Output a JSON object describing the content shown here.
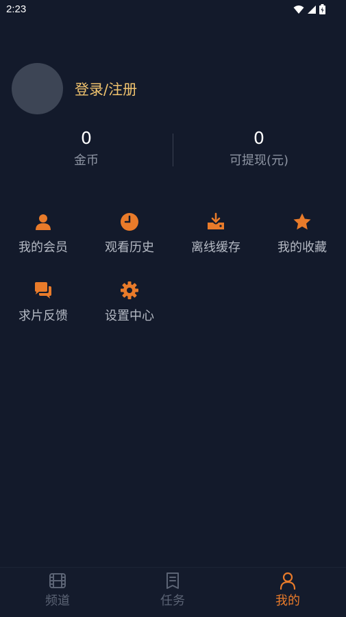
{
  "status_bar": {
    "time": "2:23"
  },
  "profile": {
    "login_label": "登录/注册"
  },
  "stats": {
    "coins": {
      "value": "0",
      "label": "金币"
    },
    "withdrawable": {
      "value": "0",
      "label": "可提现(元)"
    }
  },
  "menu": {
    "items": [
      {
        "label": "我的会员",
        "icon": "person-icon"
      },
      {
        "label": "观看历史",
        "icon": "clock-icon"
      },
      {
        "label": "离线缓存",
        "icon": "download-icon"
      },
      {
        "label": "我的收藏",
        "icon": "star-icon"
      },
      {
        "label": "求片反馈",
        "icon": "chat-icon"
      },
      {
        "label": "设置中心",
        "icon": "gear-icon"
      }
    ]
  },
  "tabbar": {
    "tabs": [
      {
        "label": "频道",
        "icon": "film-icon"
      },
      {
        "label": "任务",
        "icon": "task-icon"
      },
      {
        "label": "我的",
        "icon": "user-icon",
        "active": true
      }
    ]
  },
  "colors": {
    "background": "#131a2b",
    "accent": "#e97b2a",
    "login_text": "#f0c36e",
    "muted_text": "#8e95a3",
    "avatar": "#3d4555"
  }
}
